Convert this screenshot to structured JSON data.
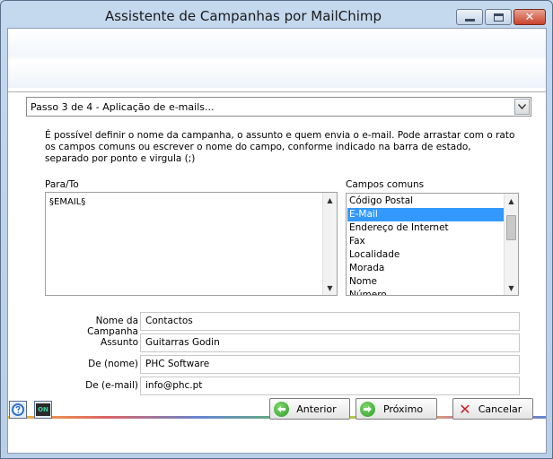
{
  "window": {
    "title": "Assistente de Campanhas por MailChimp"
  },
  "step": {
    "current": "Passo 3 de 4 - Aplicação de e-mails..."
  },
  "description": {
    "line1": "É possível definir o nome da campanha, o assunto e quem envia o e-mail. Pode arrastar com o rato",
    "line2": "os campos comuns ou escrever  o nome do campo, conforme indicado na barra de estado,",
    "line3": "separado por ponto e virgula (;)"
  },
  "to": {
    "label": "Para/To",
    "value": "§EMAIL§"
  },
  "common_fields": {
    "label": "Campos comuns",
    "items": [
      "Código Postal",
      "E-Mail",
      "Endereço de Internet",
      "Fax",
      "Localidade",
      "Morada",
      "Nome",
      "Número"
    ],
    "selected": "E-Mail",
    "scroll_position": 0.15
  },
  "form": {
    "campaign_name_label": "Nome da Campanha",
    "campaign_name_value": "Contactos",
    "subject_label": "Assunto",
    "subject_value": "Guitarras Godin",
    "from_name_label": "De (nome)",
    "from_name_value": "PHC Software",
    "from_email_label": "De (e-mail)",
    "from_email_value": "info@phc.pt"
  },
  "footer": {
    "prev_label": "Anterior",
    "next_label": "Próximo",
    "cancel_label": "Cancelar",
    "on_icon_text": "ON"
  },
  "icons": {
    "prev": "arrow-left-icon",
    "next": "arrow-right-icon",
    "cancel": "x-icon",
    "help": "help-icon",
    "on": "on-icon"
  },
  "colors": {
    "selection": "#3399ff",
    "close_button": "#c9432c",
    "nav_icon_green": "#2b9a2b"
  }
}
